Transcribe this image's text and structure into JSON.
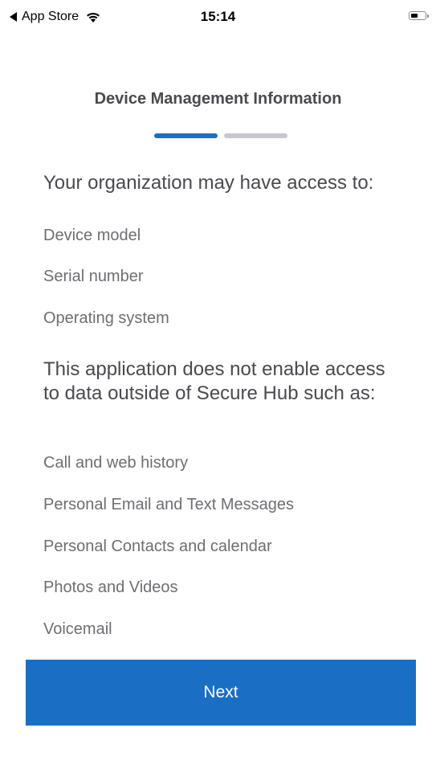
{
  "status_bar": {
    "back_label": "App Store",
    "time": "15:14"
  },
  "header": {
    "title": "Device Management Information"
  },
  "progress": {
    "steps": 2,
    "current": 1,
    "active_color": "#1a6fc4",
    "inactive_color": "#c7c7cc"
  },
  "access_section": {
    "heading": "Your organization may have access to:",
    "items": [
      "Device model",
      "Serial number",
      "Operating system"
    ]
  },
  "no_access_section": {
    "heading": "This application does not enable access to data outside of Secure Hub such as:",
    "items": [
      "Call and web history",
      "Personal Email and Text Messages",
      "Personal Contacts and calendar",
      "Photos and Videos",
      "Voicemail"
    ]
  },
  "actions": {
    "next_label": "Next"
  }
}
